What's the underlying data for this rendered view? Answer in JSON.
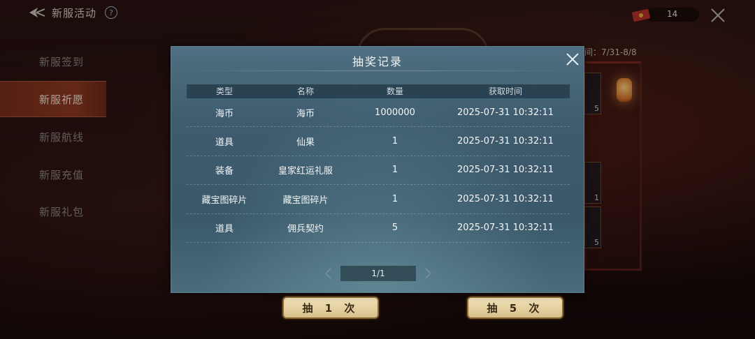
{
  "topbar": {
    "title": "新服活动",
    "help": "?",
    "currency_value": "14"
  },
  "sidebar": {
    "items": [
      {
        "label": "新服签到",
        "active": false
      },
      {
        "label": "新服祈愿",
        "active": true
      },
      {
        "label": "新服航线",
        "active": false
      },
      {
        "label": "新服充值",
        "active": false
      },
      {
        "label": "新服礼包",
        "active": false
      }
    ]
  },
  "background": {
    "period": "间：7/31-8/8",
    "slot_counts": [
      "5",
      "1",
      "5"
    ]
  },
  "actions": {
    "draw_once": "抽 1 次",
    "draw_five": "抽 5 次"
  },
  "modal": {
    "title": "抽奖记录",
    "columns": [
      "类型",
      "名称",
      "数量",
      "获取时间"
    ],
    "rows": [
      {
        "type": "海币",
        "name": "海币",
        "qty": "1000000",
        "time": "2025-07-31 10:32:11"
      },
      {
        "type": "道具",
        "name": "仙果",
        "qty": "1",
        "time": "2025-07-31 10:32:11"
      },
      {
        "type": "装备",
        "name": "皇家红运礼服",
        "qty": "1",
        "time": "2025-07-31 10:32:11"
      },
      {
        "type": "藏宝图碎片",
        "name": "藏宝图碎片",
        "qty": "1",
        "time": "2025-07-31 10:32:11"
      },
      {
        "type": "道具",
        "name": "佣兵契约",
        "qty": "5",
        "time": "2025-07-31 10:32:11"
      }
    ],
    "page": "1/1"
  },
  "icons": {
    "back": "back-arrow-icon",
    "help": "help-icon",
    "currency": "red-envelope-icon",
    "close": "close-icon",
    "prev": "chevron-left-icon",
    "next": "chevron-right-icon"
  }
}
